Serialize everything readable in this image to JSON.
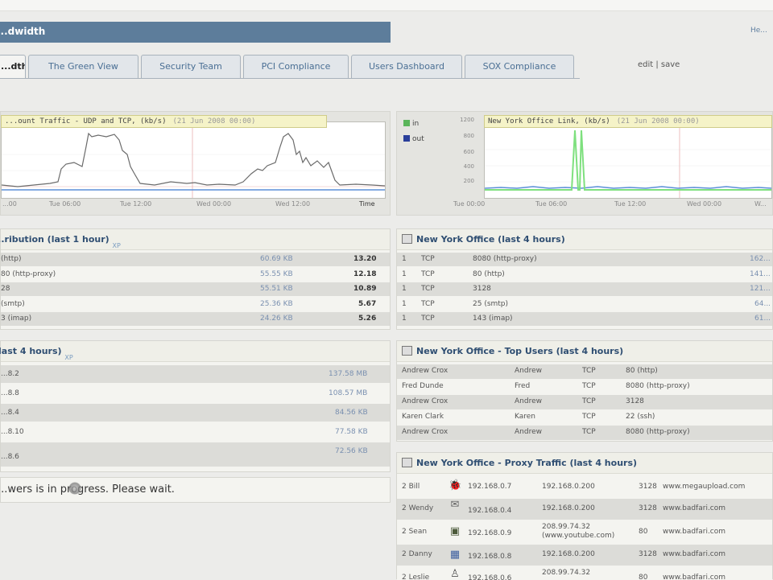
{
  "header": {
    "title": "...dwidth",
    "help_link": "He..."
  },
  "tabs": [
    {
      "label": "...dth",
      "active": true
    },
    {
      "label": "The Green View"
    },
    {
      "label": "Security Team"
    },
    {
      "label": "PCI Compliance"
    },
    {
      "label": "Users Dashboard"
    },
    {
      "label": "SOX Compliance"
    }
  ],
  "edit_link": "edit | save",
  "charts": {
    "left": {
      "title": "...ount Traffic - UDP and TCP, (kb/s)",
      "timestamp": "(21 Jun 2008 00:00)",
      "x_ticks": [
        "...00",
        "Tue 06:00",
        "Tue 12:00",
        "Wed 00:00",
        "Wed 12:00"
      ],
      "axis_label": "Time",
      "colors": {
        "line": "#6b6b6b",
        "baseline": "#5b8fd8"
      }
    },
    "right": {
      "title": "New York Office Link, (kb/s)",
      "timestamp": "(21 Jun 2008 00:00)",
      "legend": [
        {
          "label": "in",
          "color": "#5ab55a"
        },
        {
          "label": "out",
          "color": "#2a3f9a"
        }
      ],
      "y_ticks": [
        "1200",
        "800",
        "600",
        "400",
        "200"
      ],
      "x_ticks": [
        "Tue 00:00",
        "Tue 06:00",
        "Tue 12:00",
        "Wed 00:00",
        "W..."
      ],
      "colors": {
        "in": "#7ee07e",
        "out": "#5b8fd8"
      }
    }
  },
  "protocol_distribution": {
    "title": "...ribution (last 1 hour)",
    "xp": "XP",
    "rows": [
      {
        "name": "(http)",
        "size": "60.69 KB",
        "pct": "13.20"
      },
      {
        "name": "80 (http-proxy)",
        "size": "55.55 KB",
        "pct": "12.18"
      },
      {
        "name": "28",
        "size": "55.51 KB",
        "pct": "10.89"
      },
      {
        "name": "(smtp)",
        "size": "25.36 KB",
        "pct": "5.67"
      },
      {
        "name": "3 (imap)",
        "size": "24.26 KB",
        "pct": "5.26"
      }
    ]
  },
  "top_hosts": {
    "title": "(last 4 hours)",
    "xp": "XP",
    "rows": [
      {
        "host": "...8.2",
        "size": "137.58 MB"
      },
      {
        "host": "...8.8",
        "size": "108.57 MB"
      },
      {
        "host": "...8.4",
        "size": "84.56 KB"
      },
      {
        "host": "...8.10",
        "size": "77.58 KB"
      },
      {
        "host": "...8.6",
        "size": "72.56 KB"
      }
    ]
  },
  "status_message": "...wers is in progress. Please wait.",
  "ny_office": {
    "title": "New York Office (last 4 hours)",
    "rows": [
      {
        "n": "1",
        "proto": "TCP",
        "port": "8080 (http-proxy)",
        "val": "162..."
      },
      {
        "n": "1",
        "proto": "TCP",
        "port": "80 (http)",
        "val": "141..."
      },
      {
        "n": "1",
        "proto": "TCP",
        "port": "3128",
        "val": "121..."
      },
      {
        "n": "1",
        "proto": "TCP",
        "port": "25 (smtp)",
        "val": "64..."
      },
      {
        "n": "1",
        "proto": "TCP",
        "port": "143 (imap)",
        "val": "61..."
      }
    ]
  },
  "ny_top_users": {
    "title": "New York Office - Top Users (last 4 hours)",
    "rows": [
      {
        "user": "Andrew Crox",
        "short": "Andrew",
        "proto": "TCP",
        "port": "80 (http)"
      },
      {
        "user": "Fred Dunde",
        "short": "Fred",
        "proto": "TCP",
        "port": "8080 (http-proxy)"
      },
      {
        "user": "Andrew Crox",
        "short": "Andrew",
        "proto": "TCP",
        "port": "3128"
      },
      {
        "user": "Karen Clark",
        "short": "Karen",
        "proto": "TCP",
        "port": "22 (ssh)"
      },
      {
        "user": "Andrew Crox",
        "short": "Andrew",
        "proto": "TCP",
        "port": "8080 (http-proxy)"
      }
    ]
  },
  "ny_proxy": {
    "title": "New York Office - Proxy Traffic (last 4 hours)",
    "rows": [
      {
        "user": "2 Bill",
        "icon": "bug-icon",
        "glyph": "🐞",
        "src": "192.168.0.7",
        "dst": "192.168.0.200",
        "port": "3128",
        "site": "www.megaupload.com"
      },
      {
        "user": "2 Wendy",
        "icon": "mail-icon",
        "glyph": "✉",
        "src": "192.168.0.4",
        "dst": "192.168.0.200",
        "port": "3128",
        "site": "www.badfari.com"
      },
      {
        "user": "2 Sean",
        "icon": "monitor-icon",
        "glyph": "▣",
        "src": "192.168.0.9",
        "dst": "208.99.74.32 (www.youtube.com)",
        "port": "80",
        "site": "www.badfari.com"
      },
      {
        "user": "2 Danny",
        "icon": "grid-icon",
        "glyph": "▦",
        "src": "192.168.0.8",
        "dst": "192.168.0.200",
        "port": "3128",
        "site": "www.badfari.com"
      },
      {
        "user": "2 Leslie",
        "icon": "person-icon",
        "glyph": "♙",
        "src": "192.168.0.6",
        "dst": "208.99.74.32",
        "port": "80",
        "site": "www.badfari.com"
      }
    ]
  }
}
